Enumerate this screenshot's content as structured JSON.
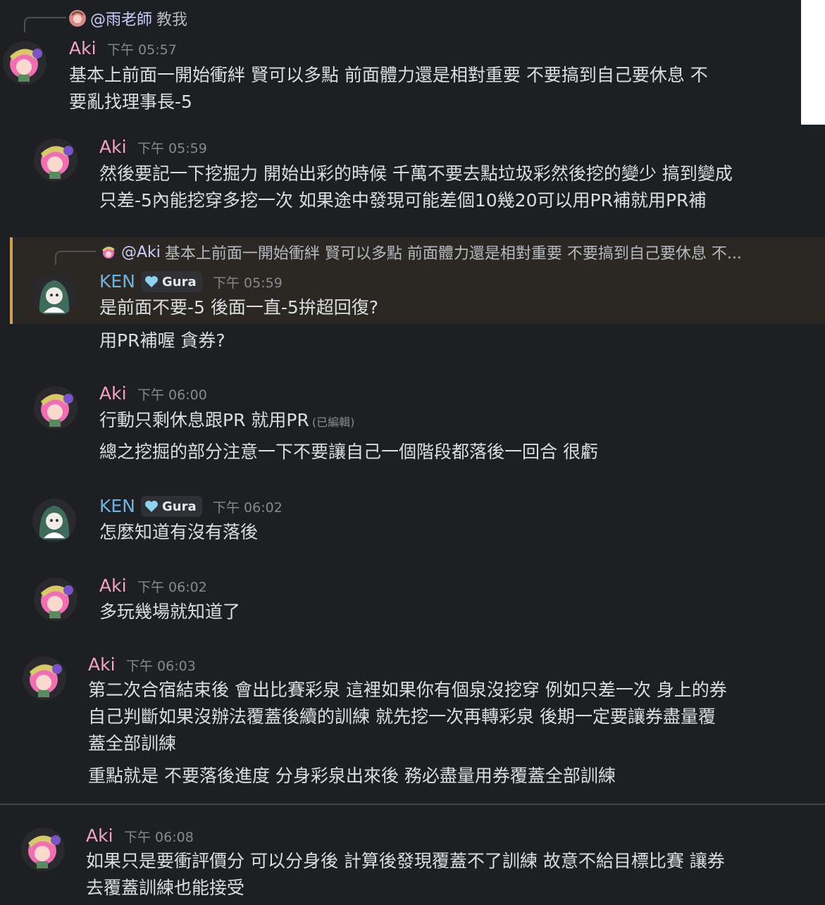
{
  "messages": [
    {
      "reply": {
        "mention": "@雨老師",
        "text": "教我"
      },
      "user": "Aki",
      "time": "下午 05:57",
      "lines": [
        "基本上前面一開始衝絆 賢可以多點 前面體力還是相對重要 不要搞到自己要休息 不",
        "要亂找理事長-5"
      ]
    },
    {
      "user": "Aki",
      "time": "下午 05:59",
      "lines": [
        "然後要記一下挖掘力 開始出彩的時候 千萬不要去點垃圾彩然後挖的變少 搞到變成",
        "只差-5內能挖穿多挖一次 如果途中發現可能差個10幾20可以用PR補就用PR補"
      ]
    },
    {
      "reply": {
        "mention": "@Aki",
        "text": "基本上前面一開始衝絆 賢可以多點 前面體力還是相對重要 不要搞到自己要休息 不..."
      },
      "user": "KEN",
      "badge": "Gura",
      "time": "下午 05:59",
      "lines": [
        "是前面不要-5 後面一直-5拚超回復?"
      ],
      "followup": "用PR補喔 貪券?"
    },
    {
      "user": "Aki",
      "time": "下午 06:00",
      "line1": "行動只剩休息跟PR 就用PR",
      "edited": "(已編輯)",
      "followup": "總之挖掘的部分注意一下不要讓自己一個階段都落後一回合 很虧"
    },
    {
      "user": "KEN",
      "badge": "Gura",
      "time": "下午 06:02",
      "lines": [
        "怎麼知道有沒有落後"
      ]
    },
    {
      "user": "Aki",
      "time": "下午 06:02",
      "lines": [
        "多玩幾場就知道了"
      ]
    },
    {
      "user": "Aki",
      "time": "下午 06:03",
      "lines": [
        "第二次合宿結束後 會出比賽彩泉 這裡如果你有個泉沒挖穿 例如只差一次 身上的券",
        "自己判斷如果沒辦法覆蓋後續的訓練 就先挖一次再轉彩泉 後期一定要讓券盡量覆",
        "蓋全部訓練"
      ],
      "followup": "重點就是 不要落後進度 分身彩泉出來後 務必盡量用券覆蓋全部訓練"
    },
    {
      "user": "Aki",
      "time": "下午 06:08",
      "lines": [
        "如果只是要衝評價分 可以分身後 計算後發現覆蓋不了訓練 故意不給目標比賽 讓券",
        "去覆蓋訓練也能接受"
      ]
    }
  ],
  "icons": {
    "aki_avatar": "pink-hair-avatar-icon",
    "ken_avatar": "ghost-hood-avatar-icon",
    "badge_icon": "heart-icon"
  },
  "colors": {
    "background": "#1e1f22",
    "aki_name": "#f4a3c8",
    "ken_name": "#6fb3e0",
    "highlight": "#2b2824",
    "highlight_bar": "#d29f53"
  }
}
